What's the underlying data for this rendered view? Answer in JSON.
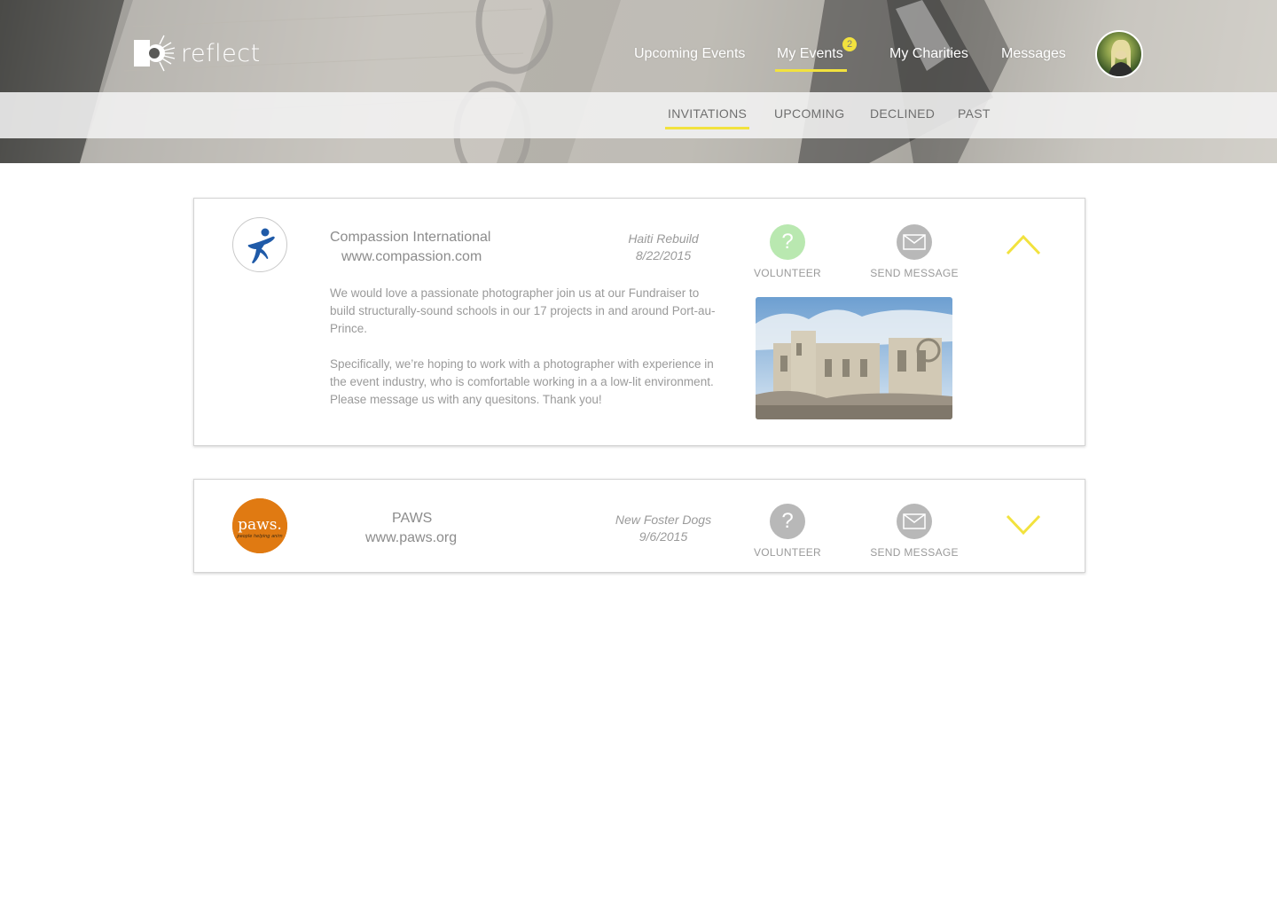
{
  "brand": {
    "name": "reflect"
  },
  "nav": {
    "items": [
      {
        "label": "Upcoming Events",
        "active": false
      },
      {
        "label": "My Events",
        "active": true,
        "badge": "2"
      },
      {
        "label": "My Charities",
        "active": false
      },
      {
        "label": "Messages",
        "active": false
      }
    ]
  },
  "subnav": {
    "tabs": [
      {
        "label": "INVITATIONS",
        "active": true
      },
      {
        "label": "UPCOMING",
        "active": false
      },
      {
        "label": "DECLINED",
        "active": false
      },
      {
        "label": "PAST",
        "active": false
      }
    ]
  },
  "invitations": [
    {
      "org_name": "Compassion International",
      "org_url": "www.compassion.com",
      "event_name": "Haiti Rebuild",
      "event_date": "8/22/2015",
      "volunteer_label": "VOLUNTEER",
      "message_label": "SEND MESSAGE",
      "volunteer_icon": "question-icon",
      "message_icon": "envelope-icon",
      "expanded": true,
      "description": [
        "We would love a passionate photographer join us at our Fundraiser to build structurally-sound schools in our 17 projects in and around Port-au-Prince.",
        "Specifically, we’re hoping to work with a photographer with experience in the event industry, who is comfortable working in a a low-lit environment. Please message us with any quesitons. Thank you!"
      ]
    },
    {
      "org_name": "PAWS",
      "org_url": "www.paws.org",
      "event_name": "New Foster Dogs",
      "event_date": "9/6/2015",
      "volunteer_label": "VOLUNTEER",
      "message_label": "SEND MESSAGE",
      "volunteer_icon": "question-icon",
      "message_icon": "envelope-icon",
      "expanded": false,
      "logo_text": "paws.",
      "logo_tagline": "people helping anim"
    }
  ],
  "colors": {
    "accent": "#f2e23e",
    "volunteer_active": "#b9e8b0",
    "icon_gray": "#b8b8b8",
    "paws_orange": "#e07a12",
    "compassion_blue": "#1f5aa8"
  }
}
